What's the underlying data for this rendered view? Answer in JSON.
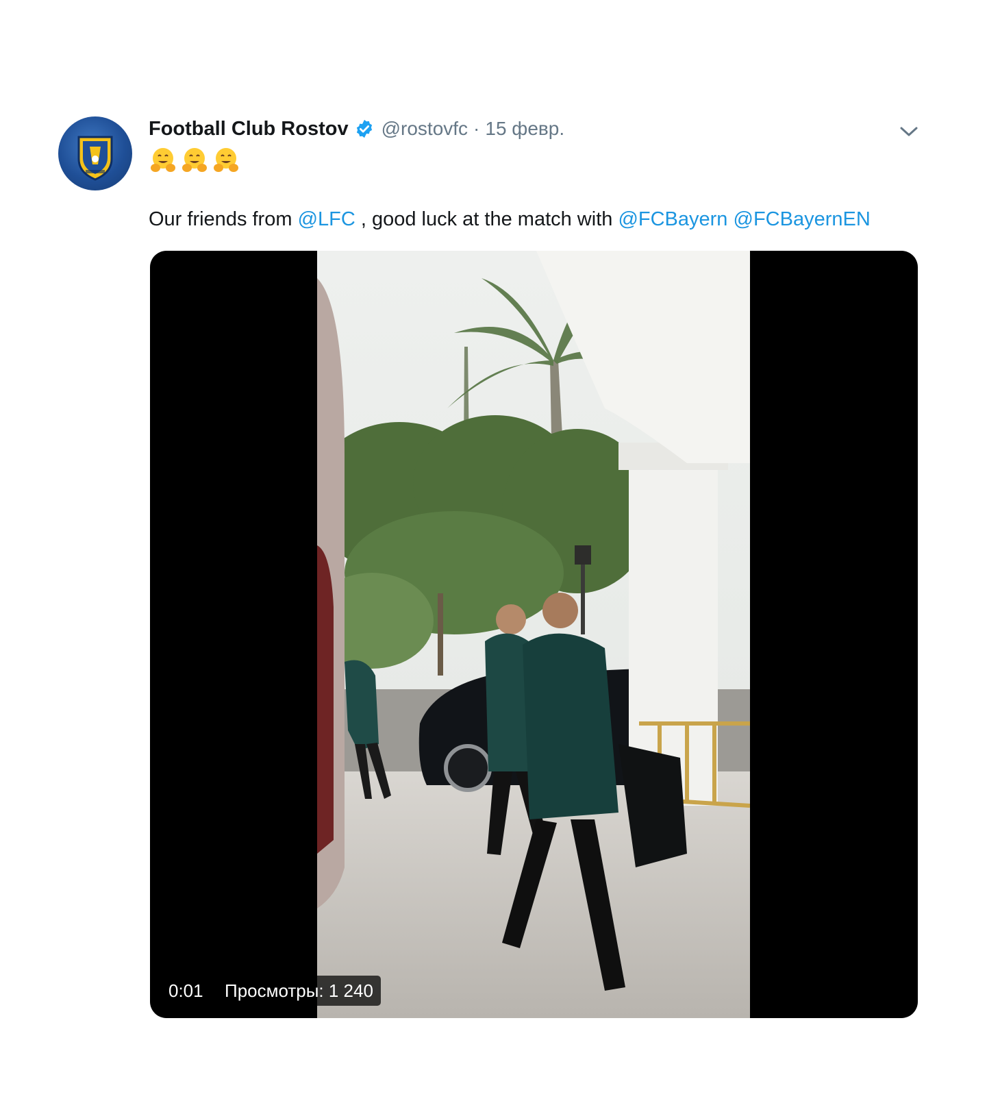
{
  "tweet": {
    "display_name": "Football Club Rostov",
    "handle": "@rostovfc",
    "separator": "·",
    "date": "15 февр.",
    "emoji_icons": [
      "hugging-face-icon",
      "hugging-face-icon",
      "hugging-face-icon"
    ],
    "text_parts": {
      "t1": "Our friends from ",
      "m1": "@LFC",
      "t2": " , good luck at the match with ",
      "m2": "@FCBayern",
      "t3": " ",
      "m3": "@FCBayernEN"
    }
  },
  "video": {
    "time": "0:01",
    "views": "Просмотры: 1 240"
  },
  "colors": {
    "text": "#14171a",
    "secondary": "#657786",
    "link": "#1b95e0",
    "verified": "#1da1f2"
  }
}
